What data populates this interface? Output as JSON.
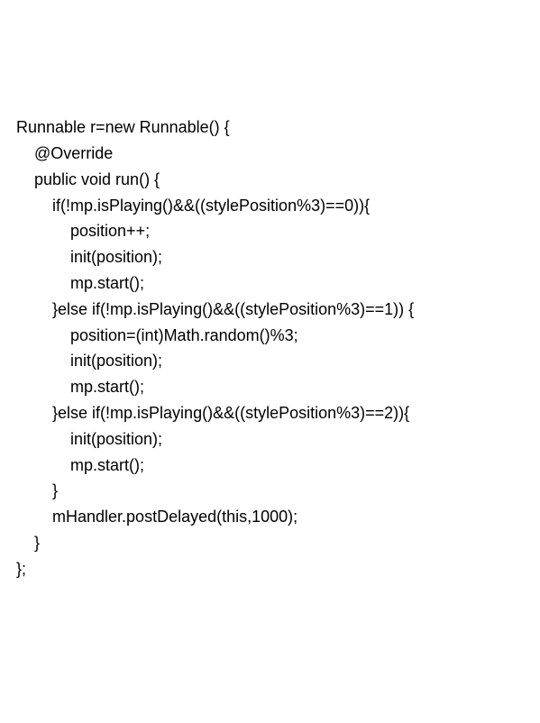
{
  "code": {
    "lines": [
      "Runnable r=new Runnable() {",
      "    @Override",
      "    public void run() {",
      "        if(!mp.isPlaying()&&((stylePosition%3)==0)){",
      "            position++;",
      "            init(position);",
      "            mp.start();",
      "        }else if(!mp.isPlaying()&&((stylePosition%3)==1)) {",
      "            position=(int)Math.random()%3;",
      "            init(position);",
      "            mp.start();",
      "        }else if(!mp.isPlaying()&&((stylePosition%3)==2)){",
      "            init(position);",
      "            mp.start();",
      "        }",
      "        mHandler.postDelayed(this,1000);",
      "    }",
      "};"
    ]
  }
}
